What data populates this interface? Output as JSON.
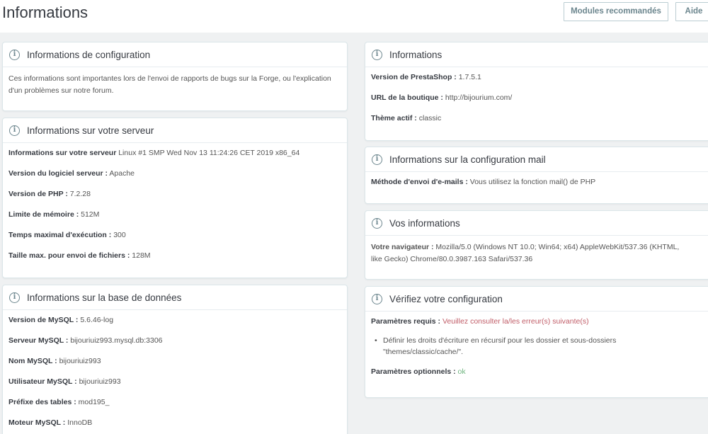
{
  "header": {
    "title": "Informations",
    "modules_button": "Modules recommandés",
    "help_button": "Aide"
  },
  "config_panel": {
    "title": "Informations de configuration",
    "text": "Ces informations sont importantes lors de l'envoi de rapports de bugs sur la Forge, ou l'explication d'un problèmes sur notre forum."
  },
  "server_panel": {
    "title": "Informations sur votre serveur",
    "rows": [
      {
        "label": "Informations sur votre serveur",
        "value": "Linux #1 SMP Wed Nov 13 11:24:26 CET 2019 x86_64"
      },
      {
        "label": "Version du logiciel serveur :",
        "value": "Apache"
      },
      {
        "label": "Version de PHP :",
        "value": "7.2.28"
      },
      {
        "label": "Limite de mémoire :",
        "value": "512M"
      },
      {
        "label": "Temps maximal d'exécution :",
        "value": "300"
      },
      {
        "label": "Taille max. pour envoi de fichiers :",
        "value": "128M"
      }
    ]
  },
  "db_panel": {
    "title": "Informations sur la base de données",
    "rows": [
      {
        "label": "Version de MySQL :",
        "value": "5.6.46-log"
      },
      {
        "label": "Serveur MySQL :",
        "value": "bijouriuiz993.mysql.db:3306"
      },
      {
        "label": "Nom MySQL :",
        "value": "bijouriuiz993"
      },
      {
        "label": "Utilisateur MySQL :",
        "value": "bijouriuiz993"
      },
      {
        "label": "Préfixe des tables :",
        "value": "mod195_"
      },
      {
        "label": "Moteur MySQL :",
        "value": "InnoDB"
      }
    ]
  },
  "info_panel": {
    "title": "Informations",
    "rows": [
      {
        "label": "Version de PrestaShop :",
        "value": "1.7.5.1"
      },
      {
        "label": "URL de la boutique :",
        "value": "http://bijourium.com/"
      },
      {
        "label": "Thème actif :",
        "value": "classic"
      }
    ]
  },
  "mail_panel": {
    "title": "Informations sur la configuration mail",
    "label": "Méthode d'envoi d'e-mails :",
    "value": "Vous utilisez la fonction mail() de PHP"
  },
  "yours_panel": {
    "title": "Vos informations",
    "label": "Votre navigateur :",
    "value_line1": "Mozilla/5.0 (Windows NT 10.0; Win64; x64) AppleWebKit/537.36 (KHTML,",
    "value_line2": "like Gecko) Chrome/80.0.3987.163 Safari/537.36"
  },
  "verify_panel": {
    "title": "Vérifiez votre configuration",
    "required_label": "Paramètres requis :",
    "required_value": "Veuillez consulter la/les erreur(s) suivante(s)",
    "bullet_line1": "Définir les droits d'écriture en récursif pour les dossier et sous-dossiers",
    "bullet_line2": "\"themes/classic/cache/\".",
    "optional_label": "Paramètres optionnels :",
    "optional_value": "ok"
  },
  "colors": {
    "error": "#c05c67",
    "ok": "#70b580",
    "background": "#eff1f2"
  },
  "icons": {
    "panel_heading": "info-circle-icon"
  }
}
